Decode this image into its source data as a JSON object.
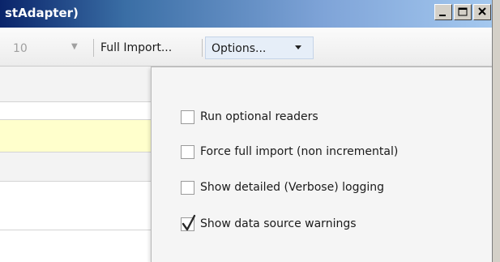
{
  "window": {
    "title": "stAdapter)",
    "buttons": [
      {
        "icon": "minimize-icon"
      },
      {
        "icon": "maximize-icon"
      },
      {
        "icon": "close-icon"
      }
    ]
  },
  "toolbar": {
    "count_value": "10",
    "full_import_label": "Full Import...",
    "options_label": "Options..."
  },
  "options_menu": {
    "items": [
      {
        "label": "Run optional readers",
        "checked": false
      },
      {
        "label": "Force full import (non incremental)",
        "checked": false
      },
      {
        "label": "Show detailed (Verbose) logging",
        "checked": false
      },
      {
        "label": "Show data source warnings",
        "checked": true
      }
    ]
  },
  "colors": {
    "title_gradient_start": "#0a246a",
    "title_gradient_end": "#a6caf0",
    "selected_row": "#ffffcc",
    "menu_background": "#f5f5f5"
  }
}
